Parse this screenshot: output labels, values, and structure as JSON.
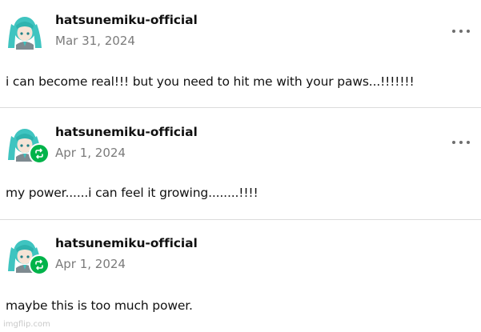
{
  "posts": [
    {
      "username": "hatsunemiku-official",
      "date": "Mar 31, 2024",
      "text": "i can become real!!! but you need to hit me with your paws...!!!!!!!",
      "reblog": false,
      "avatar_icon": "miku-avatar"
    },
    {
      "username": "hatsunemiku-official",
      "date": "Apr 1, 2024",
      "text": "my power......i can feel it growing........!!!!",
      "reblog": true,
      "avatar_icon": "miku-avatar"
    },
    {
      "username": "hatsunemiku-official",
      "date": "Apr 1, 2024",
      "text": "maybe this is too much power.",
      "reblog": true,
      "avatar_icon": "miku-avatar"
    }
  ],
  "watermark": "imgflip.com",
  "colors": {
    "reblog_badge": "#00b34a",
    "hair": "#3fc4c0",
    "date": "#7b7b7b",
    "divider": "#dcdcdc"
  }
}
